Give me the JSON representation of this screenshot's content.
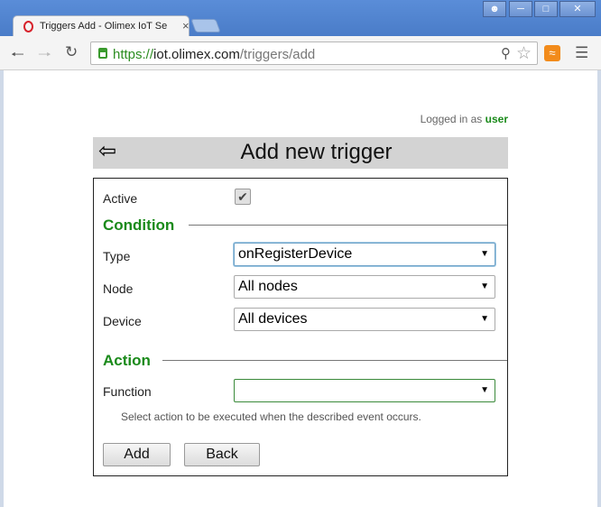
{
  "browser": {
    "tab_title": "Triggers Add - Olimex IoT Se",
    "tab_close": "×",
    "url_scheme": "https://",
    "url_host": "iot.olimex.com",
    "url_path": "/triggers/add",
    "icons": {
      "back": "arrow-left-icon",
      "forward": "arrow-right-icon",
      "reload": "reload-icon",
      "lock": "lock-icon",
      "key": "key-icon",
      "star": "star-icon",
      "rss": "rss-icon",
      "menu": "menu-icon"
    }
  },
  "session": {
    "logged_in_label": "Logged in as",
    "username": "user"
  },
  "header": {
    "title": "Add new trigger",
    "back_glyph": "⇦"
  },
  "form": {
    "active_label": "Active",
    "active_checked": true,
    "condition_heading": "Condition",
    "type_label": "Type",
    "type_value": "onRegisterDevice",
    "node_label": "Node",
    "node_value": "All nodes",
    "device_label": "Device",
    "device_value": "All devices",
    "action_heading": "Action",
    "function_label": "Function",
    "function_value": "",
    "function_hint": "Select action to be executed when the described event occurs.",
    "add_button": "Add",
    "back_button": "Back"
  },
  "colors": {
    "accent_green": "#1a8a1a",
    "header_bar": "#d3d3d3",
    "chrome_blue": "#4a7cc8"
  }
}
